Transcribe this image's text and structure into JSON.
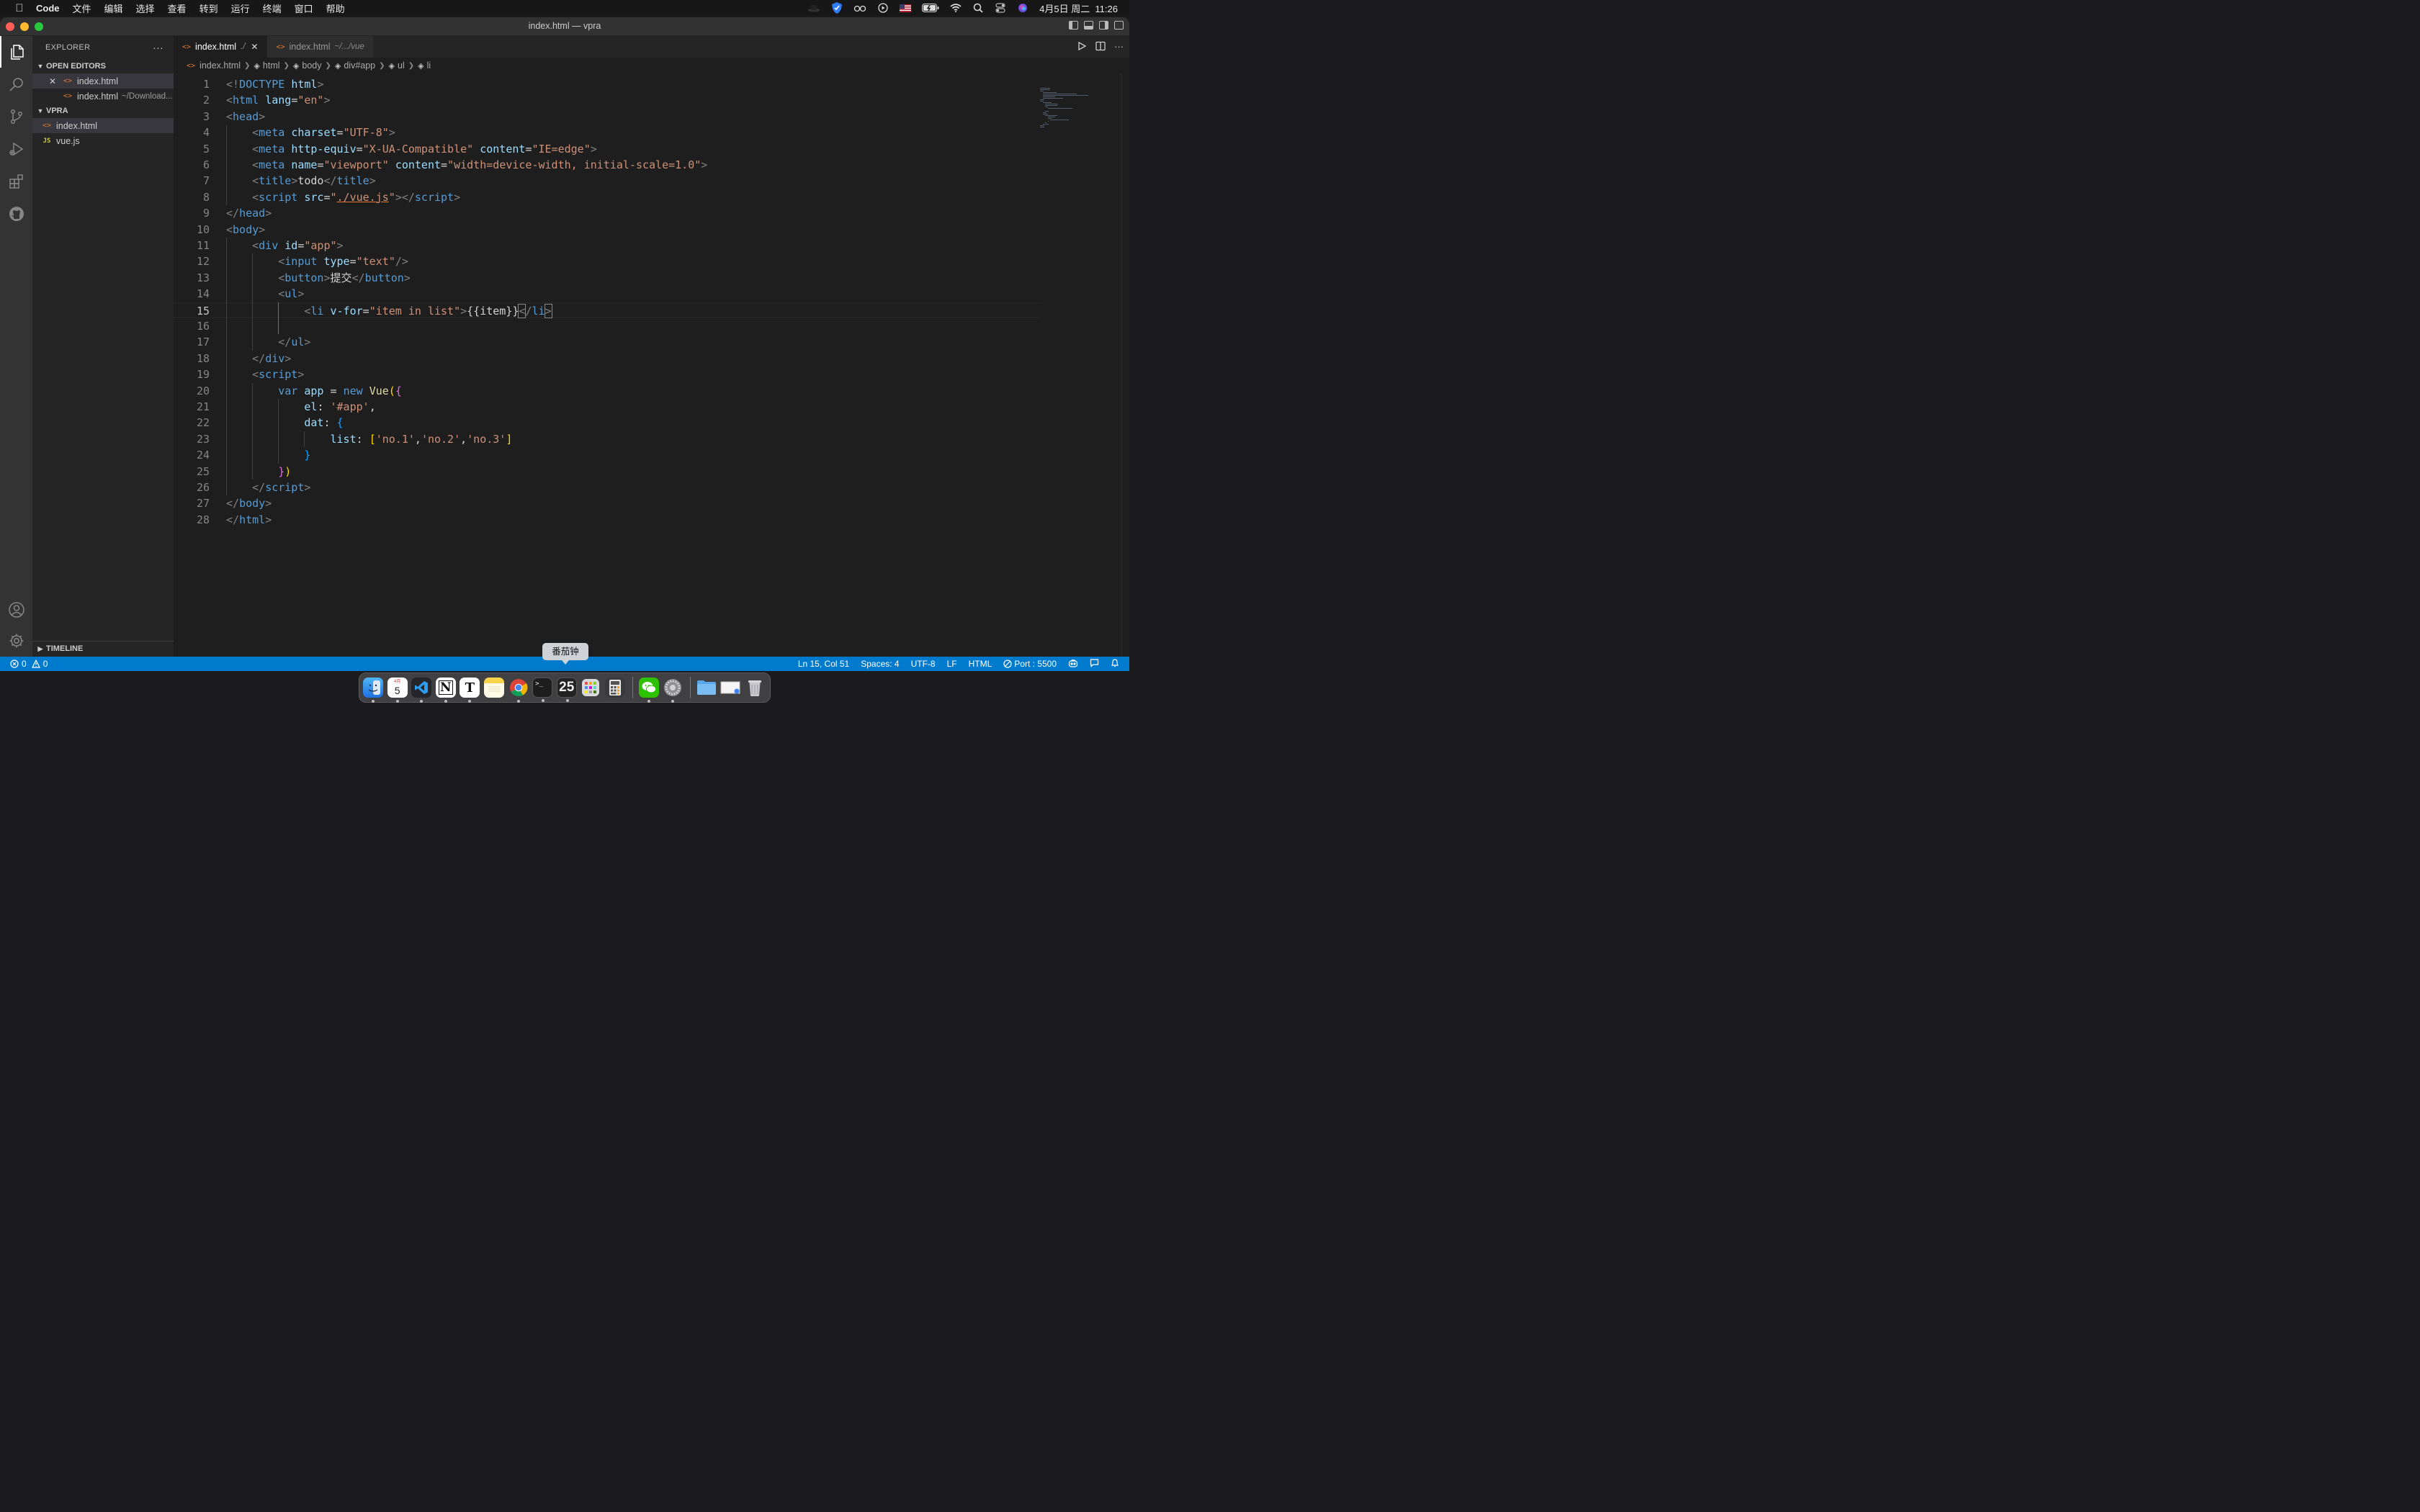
{
  "menubar": {
    "app_name": "Code",
    "items": [
      "文件",
      "编辑",
      "选择",
      "查看",
      "转到",
      "运行",
      "终端",
      "窗口",
      "帮助"
    ],
    "clock": "4月5日 周二  11:26"
  },
  "window": {
    "title": "index.html — vpra"
  },
  "sidebar": {
    "title": "EXPLORER",
    "more": "···",
    "open_editors_label": "OPEN EDITORS",
    "open_editors": [
      {
        "name": "index.html",
        "desc": "",
        "close": "✕"
      },
      {
        "name": "index.html",
        "desc": "~/Download..."
      }
    ],
    "folder_label": "VPRA",
    "files": [
      {
        "name": "index.html",
        "icon": "<>"
      },
      {
        "name": "vue.js",
        "icon": "JS"
      }
    ],
    "timeline_label": "TIMELINE"
  },
  "tabs": [
    {
      "label": "index.html",
      "desc": "./",
      "close": "✕"
    },
    {
      "label": "index.html",
      "desc": "~/.../vue"
    }
  ],
  "breadcrumb": [
    "index.html",
    "html",
    "body",
    "div#app",
    "ul",
    "li"
  ],
  "editor": {
    "current_line": 15,
    "lines": [
      [
        [
          "t-br",
          "<!"
        ],
        [
          "t-tag",
          "DOCTYPE "
        ],
        [
          "t-at",
          "html"
        ],
        [
          "t-br",
          ">"
        ]
      ],
      [
        [
          "t-br",
          "<"
        ],
        [
          "t-tag",
          "html "
        ],
        [
          "t-at",
          "lang"
        ],
        [
          "t-tx",
          "="
        ],
        [
          "t-st",
          "\"en\""
        ],
        [
          "t-br",
          ">"
        ]
      ],
      [
        [
          "t-br",
          "<"
        ],
        [
          "t-tag",
          "head"
        ],
        [
          "t-br",
          ">"
        ]
      ],
      [
        [
          "t-tx",
          "    "
        ],
        [
          "t-br",
          "<"
        ],
        [
          "t-tag",
          "meta "
        ],
        [
          "t-at",
          "charset"
        ],
        [
          "t-tx",
          "="
        ],
        [
          "t-st",
          "\"UTF-8\""
        ],
        [
          "t-br",
          ">"
        ]
      ],
      [
        [
          "t-tx",
          "    "
        ],
        [
          "t-br",
          "<"
        ],
        [
          "t-tag",
          "meta "
        ],
        [
          "t-at",
          "http-equiv"
        ],
        [
          "t-tx",
          "="
        ],
        [
          "t-st",
          "\"X-UA-Compatible\""
        ],
        [
          "t-tx",
          " "
        ],
        [
          "t-at",
          "content"
        ],
        [
          "t-tx",
          "="
        ],
        [
          "t-st",
          "\"IE=edge\""
        ],
        [
          "t-br",
          ">"
        ]
      ],
      [
        [
          "t-tx",
          "    "
        ],
        [
          "t-br",
          "<"
        ],
        [
          "t-tag",
          "meta "
        ],
        [
          "t-at",
          "name"
        ],
        [
          "t-tx",
          "="
        ],
        [
          "t-st",
          "\"viewport\""
        ],
        [
          "t-tx",
          " "
        ],
        [
          "t-at",
          "content"
        ],
        [
          "t-tx",
          "="
        ],
        [
          "t-st",
          "\"width=device-width, initial-scale=1.0\""
        ],
        [
          "t-br",
          ">"
        ]
      ],
      [
        [
          "t-tx",
          "    "
        ],
        [
          "t-br",
          "<"
        ],
        [
          "t-tag",
          "title"
        ],
        [
          "t-br",
          ">"
        ],
        [
          "t-tx",
          "todo"
        ],
        [
          "t-br",
          "</"
        ],
        [
          "t-tag",
          "title"
        ],
        [
          "t-br",
          ">"
        ]
      ],
      [
        [
          "t-tx",
          "    "
        ],
        [
          "t-br",
          "<"
        ],
        [
          "t-tag",
          "script "
        ],
        [
          "t-at",
          "src"
        ],
        [
          "t-tx",
          "="
        ],
        [
          "t-st",
          "\""
        ],
        [
          "t-st t-ul",
          "./vue.js"
        ],
        [
          "t-st",
          "\""
        ],
        [
          "t-br",
          "></"
        ],
        [
          "t-tag",
          "script"
        ],
        [
          "t-br",
          ">"
        ]
      ],
      [
        [
          "t-br",
          "</"
        ],
        [
          "t-tag",
          "head"
        ],
        [
          "t-br",
          ">"
        ]
      ],
      [
        [
          "t-br",
          "<"
        ],
        [
          "t-tag",
          "body"
        ],
        [
          "t-br",
          ">"
        ]
      ],
      [
        [
          "t-tx",
          "    "
        ],
        [
          "t-br",
          "<"
        ],
        [
          "t-tag",
          "div "
        ],
        [
          "t-at",
          "id"
        ],
        [
          "t-tx",
          "="
        ],
        [
          "t-st",
          "\"app\""
        ],
        [
          "t-br",
          ">"
        ]
      ],
      [
        [
          "t-tx",
          "        "
        ],
        [
          "t-br",
          "<"
        ],
        [
          "t-tag",
          "input "
        ],
        [
          "t-at",
          "type"
        ],
        [
          "t-tx",
          "="
        ],
        [
          "t-st",
          "\"text\""
        ],
        [
          "t-br",
          "/>"
        ]
      ],
      [
        [
          "t-tx",
          "        "
        ],
        [
          "t-br",
          "<"
        ],
        [
          "t-tag",
          "button"
        ],
        [
          "t-br",
          ">"
        ],
        [
          "t-tx",
          "提交"
        ],
        [
          "t-br",
          "</"
        ],
        [
          "t-tag",
          "button"
        ],
        [
          "t-br",
          ">"
        ]
      ],
      [
        [
          "t-tx",
          "        "
        ],
        [
          "t-br",
          "<"
        ],
        [
          "t-tag",
          "ul"
        ],
        [
          "t-br",
          ">"
        ]
      ],
      [
        [
          "t-tx",
          "            "
        ],
        [
          "t-br",
          "<"
        ],
        [
          "t-tag",
          "li "
        ],
        [
          "t-at",
          "v-for"
        ],
        [
          "t-tx",
          "="
        ],
        [
          "t-st",
          "\"item in list\""
        ],
        [
          "t-br",
          ">"
        ],
        [
          "t-tx",
          "{{item}}"
        ],
        [
          "t-br brk",
          "<"
        ],
        [
          "t-br",
          "/"
        ],
        [
          "t-tag",
          "li"
        ],
        [
          "t-br brk",
          ">"
        ]
      ],
      [
        [
          "t-tx",
          ""
        ]
      ],
      [
        [
          "t-tx",
          "        "
        ],
        [
          "t-br",
          "</"
        ],
        [
          "t-tag",
          "ul"
        ],
        [
          "t-br",
          ">"
        ]
      ],
      [
        [
          "t-tx",
          "    "
        ],
        [
          "t-br",
          "</"
        ],
        [
          "t-tag",
          "div"
        ],
        [
          "t-br",
          ">"
        ]
      ],
      [
        [
          "t-tx",
          "    "
        ],
        [
          "t-br",
          "<"
        ],
        [
          "t-tag",
          "script"
        ],
        [
          "t-br",
          ">"
        ]
      ],
      [
        [
          "t-tx",
          "        "
        ],
        [
          "t-kw",
          "var "
        ],
        [
          "t-var",
          "app"
        ],
        [
          "t-tx",
          " = "
        ],
        [
          "t-kw",
          "new "
        ],
        [
          "t-fn",
          "Vue"
        ],
        [
          "t-b1",
          "("
        ],
        [
          "t-b2",
          "{"
        ]
      ],
      [
        [
          "t-tx",
          "            "
        ],
        [
          "t-var",
          "el"
        ],
        [
          "t-tx",
          ": "
        ],
        [
          "t-st",
          "'#app'"
        ],
        [
          "t-tx",
          ","
        ]
      ],
      [
        [
          "t-tx",
          "            "
        ],
        [
          "t-var",
          "dat"
        ],
        [
          "t-tx",
          ": "
        ],
        [
          "t-b3",
          "{"
        ]
      ],
      [
        [
          "t-tx",
          "                "
        ],
        [
          "t-var",
          "list"
        ],
        [
          "t-tx",
          ": "
        ],
        [
          "t-b1",
          "["
        ],
        [
          "t-st",
          "'no.1'"
        ],
        [
          "t-tx",
          ","
        ],
        [
          "t-st",
          "'no.2'"
        ],
        [
          "t-tx",
          ","
        ],
        [
          "t-st",
          "'no.3'"
        ],
        [
          "t-b1",
          "]"
        ]
      ],
      [
        [
          "t-tx",
          "            "
        ],
        [
          "t-b3",
          "}"
        ]
      ],
      [
        [
          "t-tx",
          "        "
        ],
        [
          "t-b2",
          "}"
        ],
        [
          "t-b1",
          ")"
        ]
      ],
      [
        [
          "t-tx",
          "    "
        ],
        [
          "t-br",
          "</"
        ],
        [
          "t-tag",
          "script"
        ],
        [
          "t-br",
          ">"
        ]
      ],
      [
        [
          "t-br",
          "</"
        ],
        [
          "t-tag",
          "body"
        ],
        [
          "t-br",
          ">"
        ]
      ],
      [
        [
          "t-br",
          "</"
        ],
        [
          "t-tag",
          "html"
        ],
        [
          "t-br",
          ">"
        ]
      ]
    ]
  },
  "statusbar": {
    "errors": "0",
    "warnings": "0",
    "position": "Ln 15, Col 51",
    "spaces": "Spaces: 4",
    "encoding": "UTF-8",
    "eol": "LF",
    "language": "HTML",
    "port": "Port : 5500"
  },
  "tooltip": "番茄钟",
  "dock": {
    "calendar_month": "4月",
    "calendar_day": "5",
    "timer_value": "25",
    "apps": [
      "finder-icon",
      "calendar-icon",
      "vscode-icon",
      "notion-icon",
      "typora-icon",
      "notes-icon",
      "chrome-icon",
      "terminal-icon",
      "timer-icon",
      "launchpad-icon",
      "calculator-icon",
      "wechat-icon",
      "system-preferences-icon",
      "folder-icon",
      "preview-icon",
      "trash-icon"
    ]
  }
}
